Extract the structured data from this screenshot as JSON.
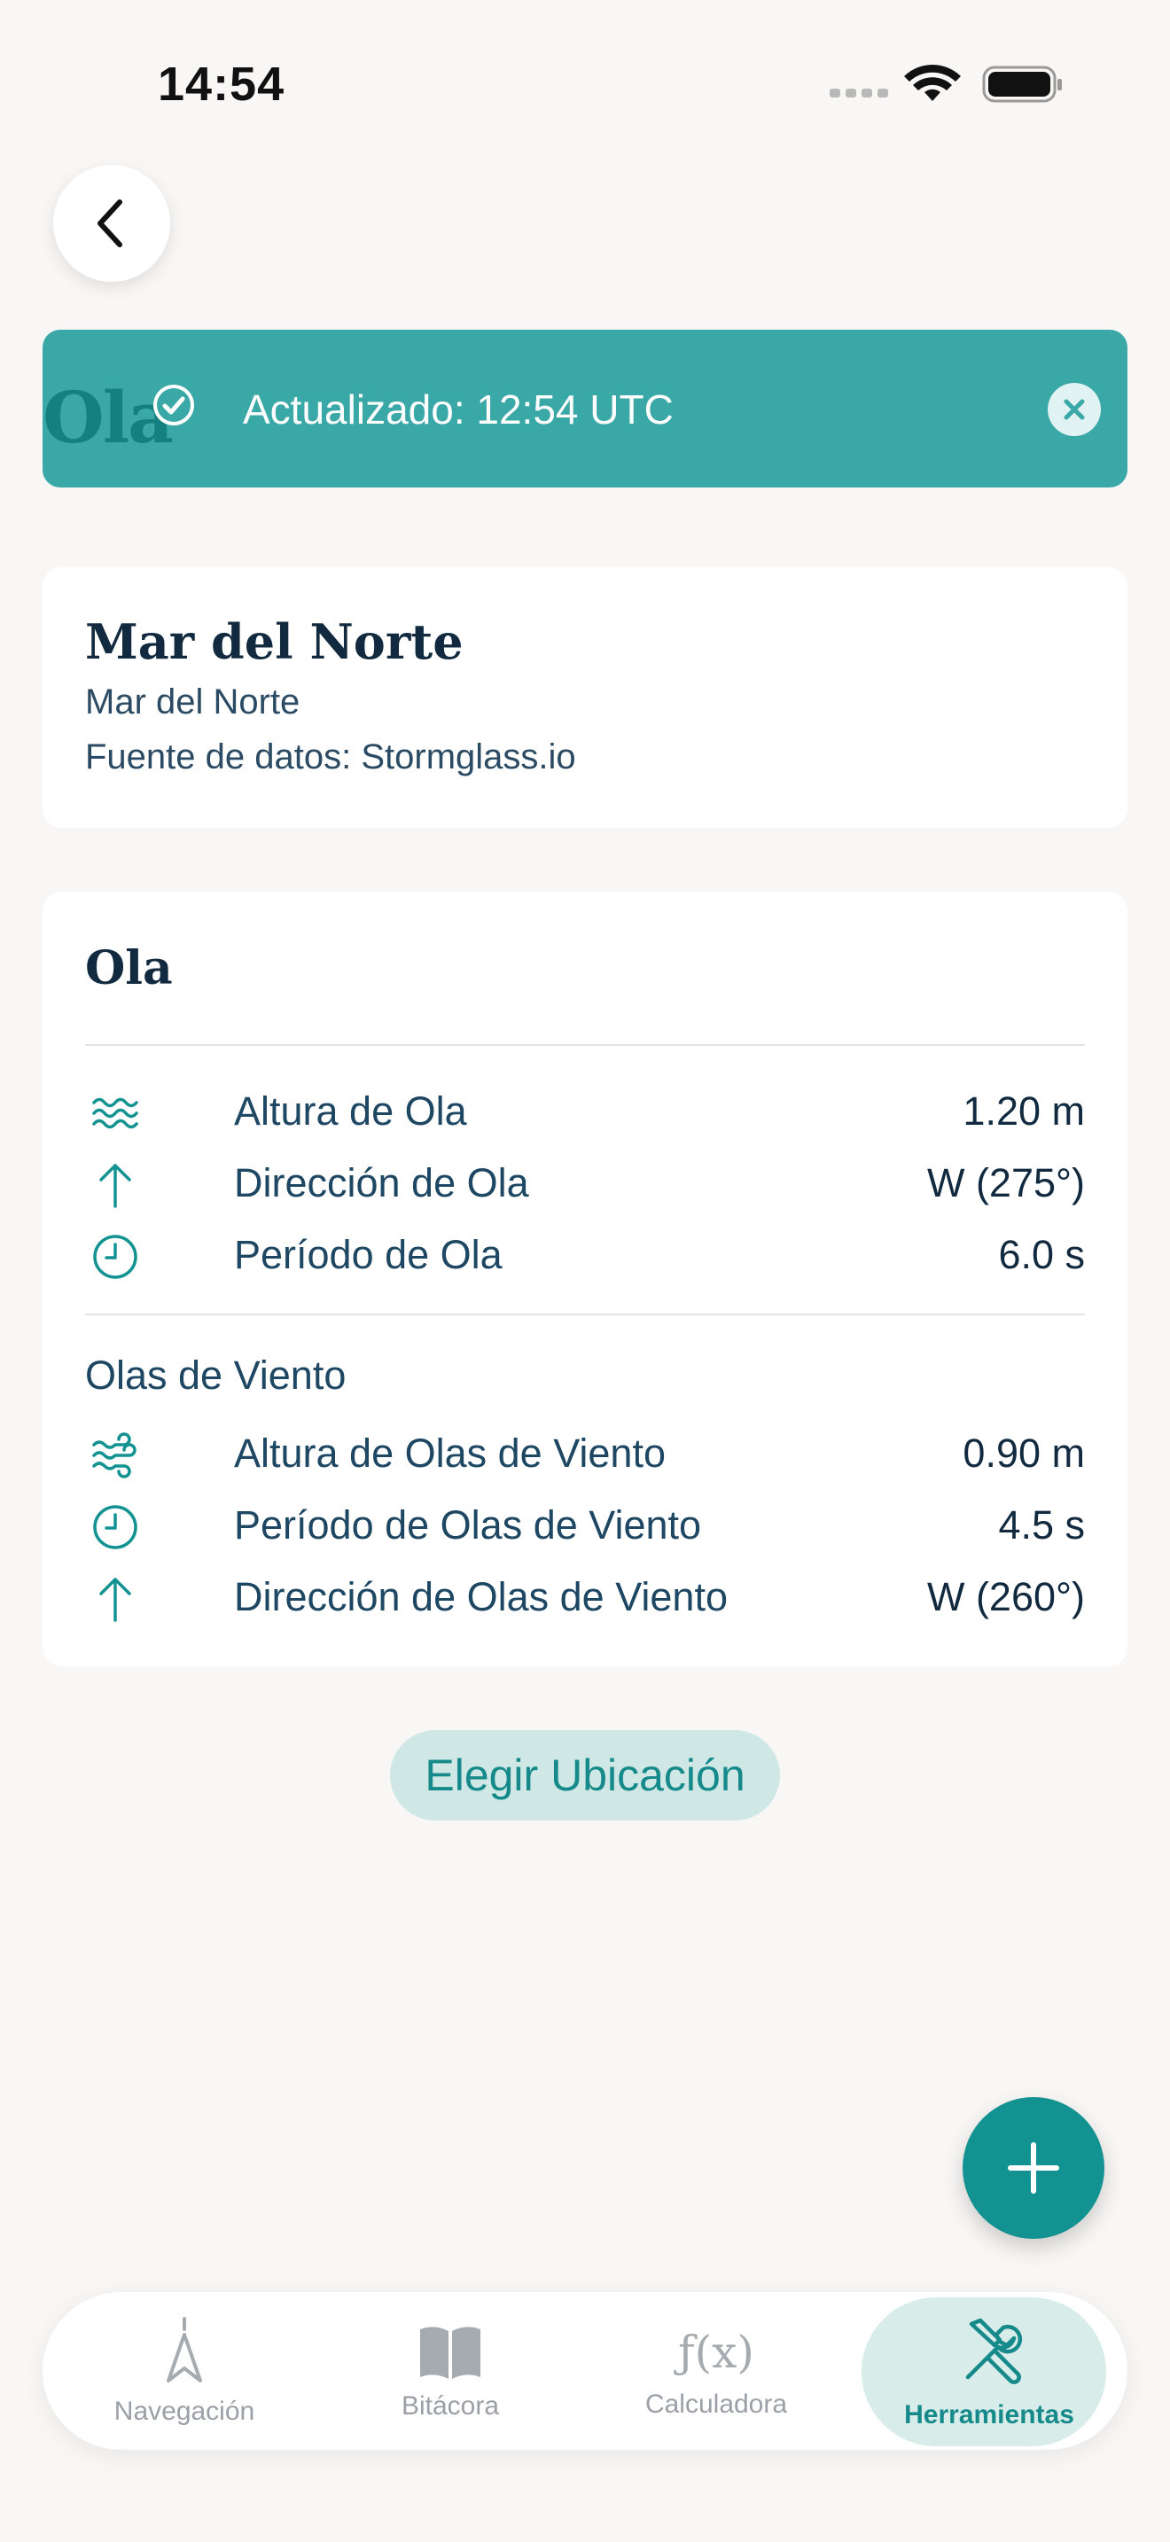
{
  "status_bar": {
    "time": "14:54"
  },
  "toast": {
    "ghost_text": "Ola",
    "message": "Actualizado: 12:54 UTC"
  },
  "location": {
    "title": "Mar del Norte",
    "subtitle": "Mar del Norte",
    "source": "Fuente de datos: Stormglass.io"
  },
  "wave": {
    "title": "Ola",
    "rows": [
      {
        "icon": "waves-icon",
        "label": "Altura de Ola",
        "value": "1.20 m"
      },
      {
        "icon": "arrow-up-icon",
        "label": "Dirección de Ola",
        "value": "W (275°)"
      },
      {
        "icon": "clock-icon",
        "label": "Período de Ola",
        "value": "6.0 s"
      }
    ],
    "wind_waves_title": "Olas de Viento",
    "wind_rows": [
      {
        "icon": "wind-icon",
        "label": "Altura de Olas de Viento",
        "value": "0.90 m"
      },
      {
        "icon": "clock-icon",
        "label": "Período de Olas de Viento",
        "value": "4.5 s"
      },
      {
        "icon": "arrow-up-icon",
        "label": "Dirección de Olas de Viento",
        "value": "W (260°)"
      }
    ]
  },
  "choose_location_label": "Elegir Ubicación",
  "tabs": [
    {
      "label": "Navegación",
      "icon": "compass-icon",
      "active": false
    },
    {
      "label": "Bitácora",
      "icon": "book-icon",
      "active": false
    },
    {
      "label": "Calculadora",
      "icon": "function-icon",
      "glyph": "ƒ(x)",
      "active": false
    },
    {
      "label": "Herramientas",
      "icon": "tools-icon",
      "active": true
    }
  ],
  "colors": {
    "accent": "#139292",
    "toast": "#3ba8a8",
    "background": "#f9f7f5",
    "text": "#1c3a52"
  }
}
